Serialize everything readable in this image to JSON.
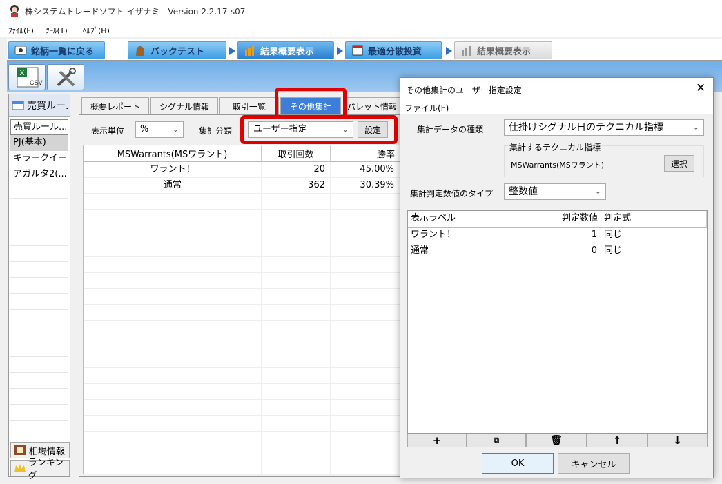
{
  "app": {
    "title": "株システムトレードソフト イザナミ - Version 2.2.17-s07"
  },
  "menu": {
    "file": "ﾌｧｲﾙ(F)",
    "tools": "ﾂｰﾙ(T)",
    "help": "ﾍﾙﾌﾟ(H)"
  },
  "main_tabs": [
    {
      "label": "銘柄一覧に戻る"
    },
    {
      "label": "バックテスト"
    },
    {
      "label": "結果概要表示"
    },
    {
      "label": "最適分散投資"
    },
    {
      "label": "結果概要表示"
    }
  ],
  "sidebar": {
    "header": "売買ルー.",
    "items": [
      "売買ルール...",
      "PJ(基本)",
      "キラークイー...",
      "アガルタ2(..."
    ],
    "footer": [
      "相場情報",
      "ランキング"
    ]
  },
  "sub_tabs": [
    "概要レポート",
    "シグナル情報",
    "取引一覧",
    "その他集計",
    "パレット情報"
  ],
  "filters": {
    "unit_label": "表示単位",
    "unit_value": "%",
    "category_label": "集計分類",
    "category_value": "ユーザー指定",
    "settings_button": "設定"
  },
  "grid": {
    "columns": [
      "MSWarrants(MSワラント)",
      "取引回数",
      "勝率"
    ],
    "rows": [
      {
        "name": "ワラント！",
        "count": "20",
        "rate": "45.00%"
      },
      {
        "name": "通常",
        "count": "362",
        "rate": "30.39%"
      }
    ]
  },
  "dialog": {
    "title": "その他集計のユーザー指定設定",
    "menu_file": "ファイル(F)",
    "data_type_label": "集計データの種類",
    "data_type_value": "仕掛けシグナル日のテクニカル指標",
    "indicator_group_label": "集計するテクニカル指標",
    "indicator_value": "MSWarrants(MSワラント)",
    "select_button": "選択",
    "judge_type_label": "集計判定数値のタイプ",
    "judge_type_value": "整数値",
    "columns": [
      "表示ラベル",
      "判定数値",
      "判定式"
    ],
    "rows": [
      {
        "label": "ワラント！",
        "value": "1",
        "expr": "同じ"
      },
      {
        "label": "通常",
        "value": "0",
        "expr": "同じ"
      }
    ],
    "ok": "OK",
    "cancel": "キャンセル"
  },
  "colors": {
    "accent": "#3d7fd8",
    "highlight": "#e00000"
  }
}
